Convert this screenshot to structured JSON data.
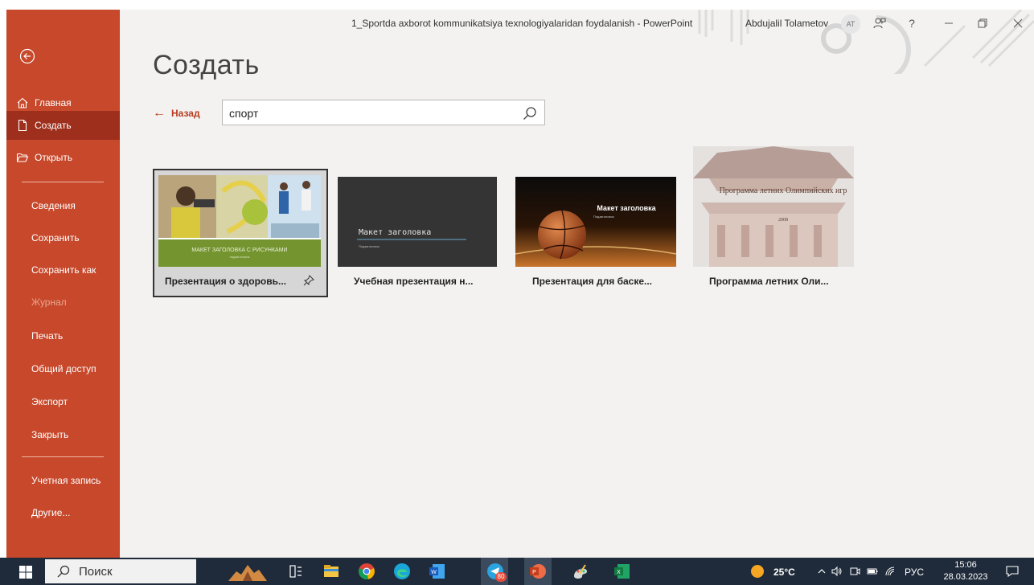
{
  "window": {
    "title": "1_Sportda axborot kommunikatsiya texnologiyalaridan foydalanish - PowerPoint",
    "user_name": "Abdujalil Tolametov",
    "user_initials": "AT",
    "help": "?"
  },
  "sidebar": {
    "items": [
      {
        "label": "Главная"
      },
      {
        "label": "Создать"
      },
      {
        "label": "Открыть"
      },
      {
        "label": "Сведения"
      },
      {
        "label": "Сохранить"
      },
      {
        "label": "Сохранить как"
      },
      {
        "label": "Журнал"
      },
      {
        "label": "Печать"
      },
      {
        "label": "Общий доступ"
      },
      {
        "label": "Экспорт"
      },
      {
        "label": "Закрыть"
      },
      {
        "label": "Учетная запись"
      },
      {
        "label": "Другие..."
      }
    ]
  },
  "main": {
    "heading": "Создать",
    "back_label": "Назад",
    "search": {
      "value": "спорт"
    }
  },
  "templates": [
    {
      "label": "Презентация о здоровь...",
      "thumb_caption": "МАКЕТ ЗАГОЛОВКА С РИСУНКАМИ",
      "thumb_sub": "подзаголовок"
    },
    {
      "label": "Учебная презентация н...",
      "thumb_caption": "Макет заголовка",
      "thumb_sub": "Подзаголовок"
    },
    {
      "label": "Презентация для баске...",
      "thumb_caption": "Макет заголовка",
      "thumb_sub": "Подзаголовок"
    },
    {
      "label": "Программа летних Оли...",
      "thumb_caption": "Программа летних Олимпийских игр",
      "thumb_sub": "2008"
    }
  ],
  "taskbar": {
    "search_label": "Поиск",
    "badge": "80",
    "temperature": "25°C",
    "language": "РУС",
    "time": "15:06",
    "date": "28.03.2023"
  },
  "colors": {
    "accent": "#c7482b",
    "accent_active": "#9e2f1c",
    "background": "#f3f2f1",
    "taskbar": "#1f2b3a"
  }
}
